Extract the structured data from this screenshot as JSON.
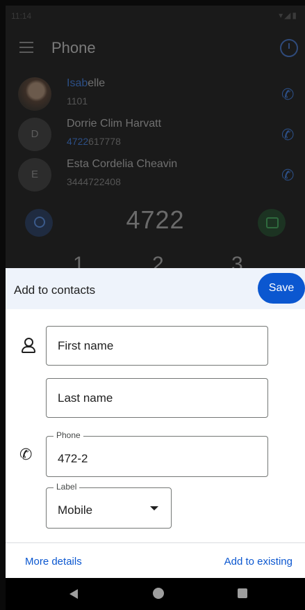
{
  "dialer": {
    "app_title": "Phone",
    "contacts": [
      {
        "name_hl": "Isab",
        "name_rest": "elle",
        "number_hl": "",
        "number_rest": "1101",
        "avatar_letter": ""
      },
      {
        "name_hl": "",
        "name_rest": "Dorrie Clim Harvatt",
        "number_hl": "4722",
        "number_rest": "617778",
        "avatar_letter": "D"
      },
      {
        "name_hl": "",
        "name_rest": "Esta Cordelia Cheavin",
        "number_hl": "",
        "number_rest": "3444722408",
        "avatar_letter": "E"
      }
    ],
    "typed_digits": "4722",
    "keys": [
      "1",
      "2",
      "3"
    ]
  },
  "sheet": {
    "title": "Add to contacts",
    "save_label": "Save",
    "first_name_placeholder": "First name",
    "last_name_placeholder": "Last name",
    "phone_label": "Phone",
    "phone_value": "472-2",
    "label_label": "Label",
    "label_value": "Mobile",
    "more_details": "More details",
    "add_to_existing": "Add to existing"
  },
  "colors": {
    "accent": "#0b57d0",
    "header_bg": "#eef3fb"
  }
}
